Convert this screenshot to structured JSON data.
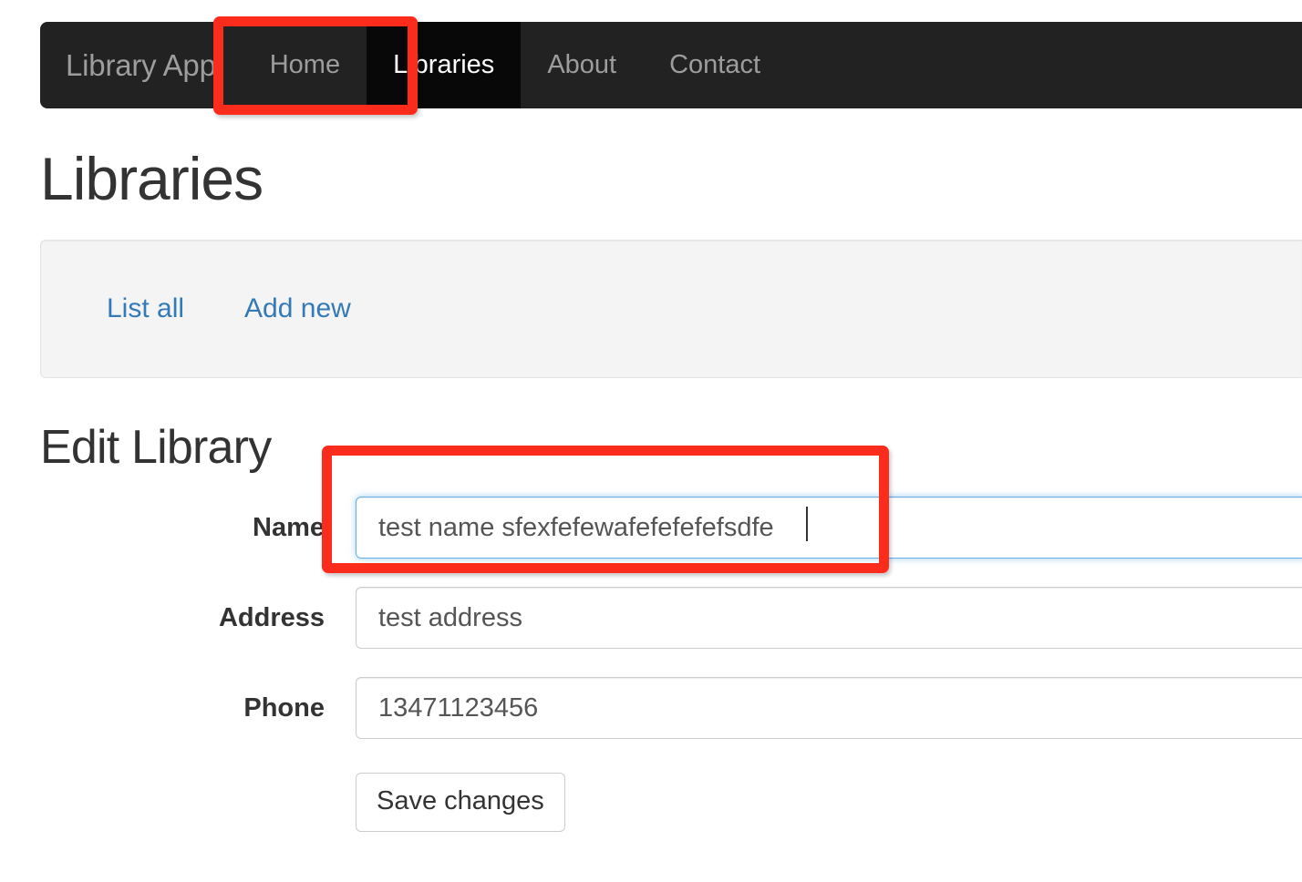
{
  "navbar": {
    "brand": "Library App",
    "background_color": "#222222",
    "link_color": "#9d9d9d",
    "active_color": "#ffffff",
    "active_background": "#080808",
    "items": [
      {
        "label": "Home",
        "active": false
      },
      {
        "label": "Libraries",
        "active": true
      },
      {
        "label": "About",
        "active": false
      },
      {
        "label": "Contact",
        "active": false
      }
    ]
  },
  "page": {
    "title": "Libraries"
  },
  "tabs": {
    "panel_background": "#f4f4f4",
    "link_color": "#337ab7",
    "items": [
      {
        "label": "List all"
      },
      {
        "label": "Add new"
      }
    ]
  },
  "form": {
    "heading": "Edit Library",
    "fields": [
      {
        "label": "Name",
        "value": "test name sfexfefewafefefefefsdfe",
        "focused": true,
        "focus_border_color": "#66afe9"
      },
      {
        "label": "Address",
        "value": "test address",
        "focused": false
      },
      {
        "label": "Phone",
        "value": "13471123456",
        "focused": false
      }
    ],
    "submit_label": "Save changes"
  },
  "annotations": {
    "color": "#fb2c1c",
    "boxes": [
      {
        "target": "Home"
      },
      {
        "target": "Name"
      }
    ]
  }
}
